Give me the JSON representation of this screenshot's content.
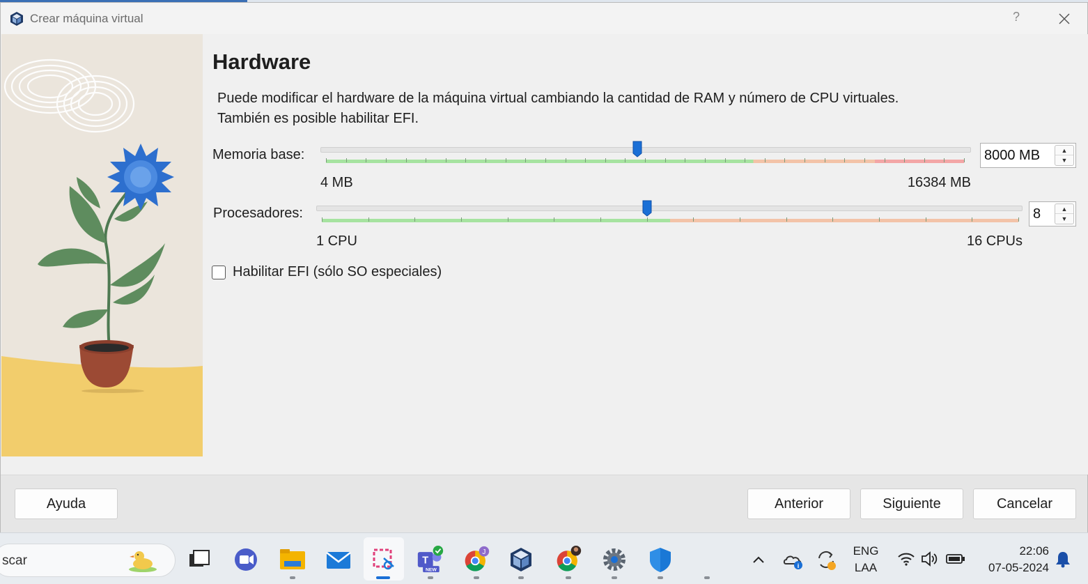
{
  "window": {
    "title": "Crear máquina virtual",
    "help_glyph": "?",
    "app_icon": "virtualbox-icon"
  },
  "page": {
    "heading": "Hardware",
    "description_line1": "Puede modificar el hardware de la máquina virtual cambiando la cantidad de RAM y número de CPU virtuales.",
    "description_line2": "También es posible habilitar EFI."
  },
  "memory": {
    "label": "Memoria base:",
    "value": "8000 MB",
    "min_label": "4 MB",
    "max_label": "16384 MB",
    "min": 4,
    "max": 16384,
    "current": 8000
  },
  "processors": {
    "label": "Procesadores:",
    "value": "8",
    "min_label": "1 CPU",
    "max_label": "16 CPUs",
    "min": 1,
    "max": 16,
    "current": 8
  },
  "efi": {
    "label": "Habilitar EFI (sólo SO especiales)",
    "checked": false
  },
  "buttons": {
    "help": "Ayuda",
    "back": "Anterior",
    "next": "Siguiente",
    "cancel": "Cancelar"
  },
  "taskbar": {
    "search_text": "scar",
    "tray_lang_top": "ENG",
    "tray_lang_bottom": "LAA",
    "time": "22:06",
    "date": "07-05-2024",
    "new_badge": "NEW",
    "chrome_badge": "J"
  },
  "colors": {
    "accent": "#1a6fd6",
    "scale_green": "#a6e3a0",
    "scale_orange": "#f3c3a8",
    "scale_red": "#f3a6a6"
  }
}
